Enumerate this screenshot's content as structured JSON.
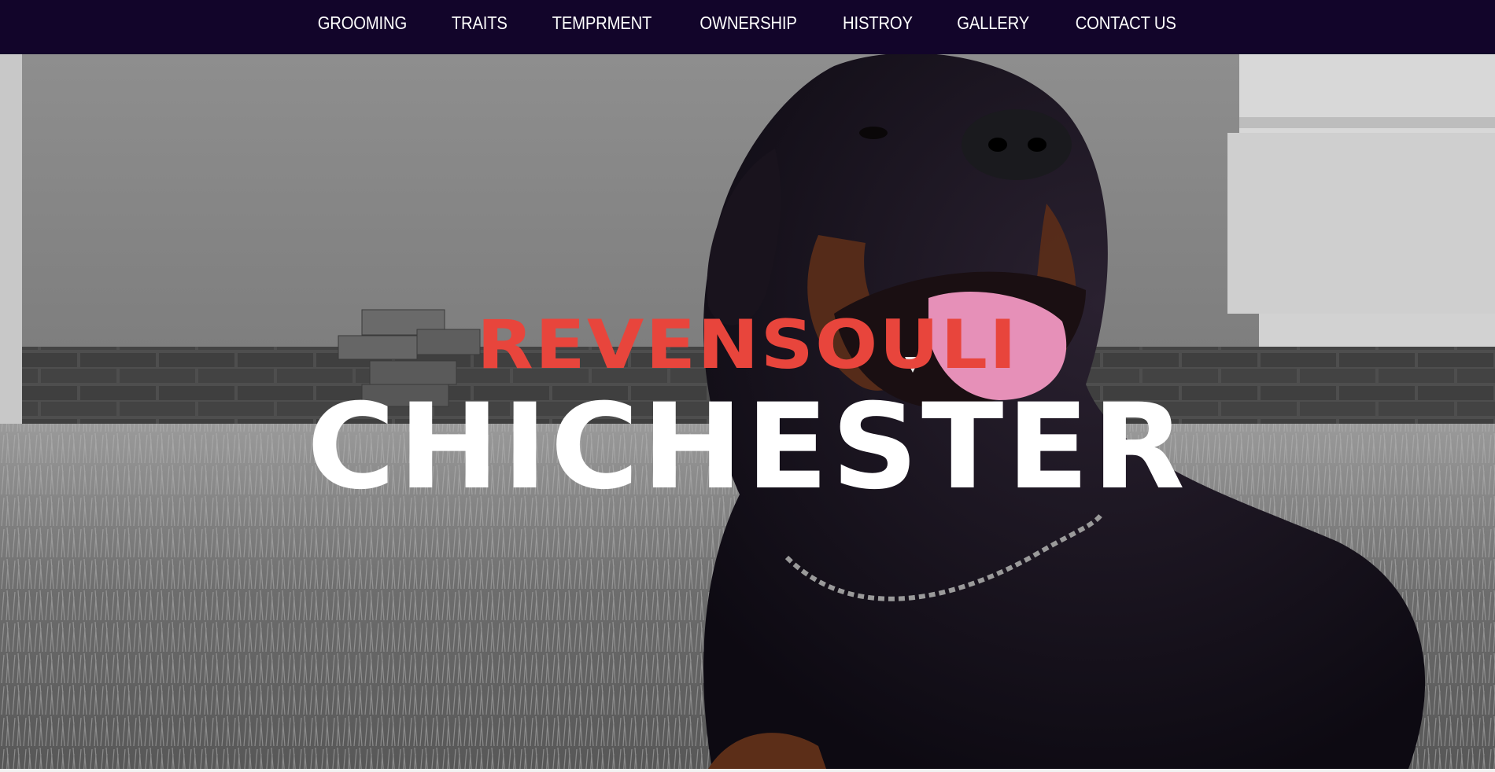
{
  "nav": {
    "items": [
      {
        "label": "GROOMING"
      },
      {
        "label": "TRAITS"
      },
      {
        "label": "TEMPRMENT"
      },
      {
        "label": "OWNERSHIP"
      },
      {
        "label": "HISTROY"
      },
      {
        "label": "GALLERY"
      },
      {
        "label": "CONTACT US"
      }
    ]
  },
  "hero": {
    "title_top": "REVENSOULI",
    "title_bottom": "CHICHESTER",
    "colors": {
      "nav_background": "#12052a",
      "title_top": "#e8453c",
      "title_bottom": "#ffffff"
    }
  }
}
